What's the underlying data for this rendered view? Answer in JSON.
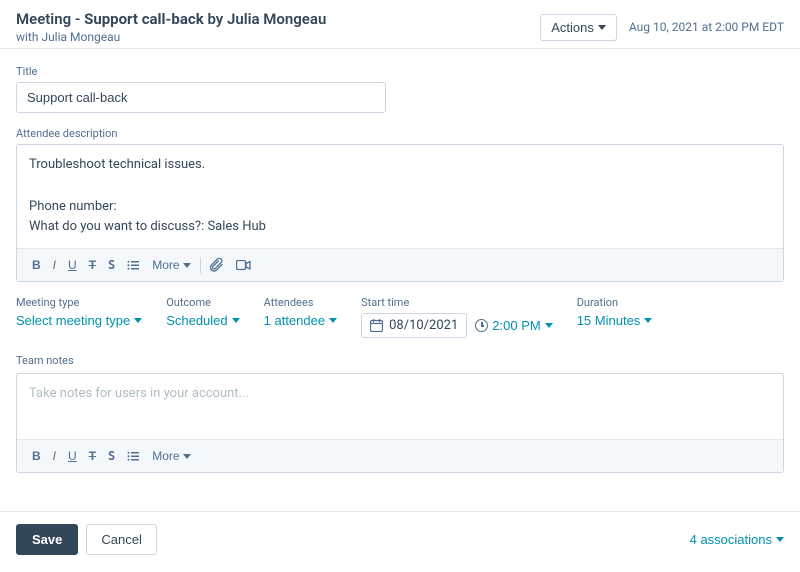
{
  "header": {
    "title_prefix": "Meeting - ",
    "title_bold": "Support call-back",
    "title_suffix": " by Julia Mongeau",
    "subtitle": "with Julia Mongeau",
    "actions_label": "Actions",
    "timestamp": "Aug 10, 2021 at 2:00 PM EDT"
  },
  "form": {
    "title_label": "Title",
    "title_value": "Support call-back",
    "attendee_label": "Attendee description",
    "attendee_content_line1": "Troubleshoot technical issues.",
    "attendee_content_line2": "",
    "attendee_content_line3": "Phone number:",
    "attendee_content_line4": "What do you want to discuss?: Sales Hub",
    "toolbar": {
      "bold": "B",
      "italic": "I",
      "underline": "U",
      "strikethrough": "S̶",
      "more": "More",
      "list_icon": "≡"
    },
    "meeting_type_label": "Meeting type",
    "meeting_type_value": "Select meeting type",
    "outcome_label": "Outcome",
    "outcome_value": "Scheduled",
    "attendees_label": "Attendees",
    "attendees_value": "1 attendee",
    "start_time_label": "Start time",
    "start_date_value": "08/10/2021",
    "start_time_value": "2:00 PM",
    "duration_label": "Duration",
    "duration_value": "15 Minutes",
    "team_notes_label": "Team notes",
    "team_notes_placeholder": "Take notes for users in your account...",
    "toolbar2": {
      "bold": "B",
      "italic": "I",
      "underline": "U",
      "strikethrough": "S̶",
      "more": "More"
    }
  },
  "footer": {
    "save_label": "Save",
    "cancel_label": "Cancel",
    "associations_label": "4 associations"
  }
}
